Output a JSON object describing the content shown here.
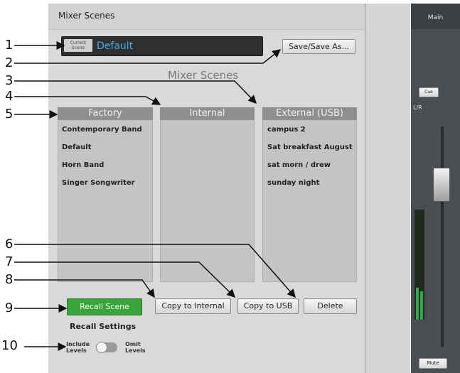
{
  "window_title": "Mixer Scenes",
  "current_scene": {
    "tag": "Current Scene",
    "name": "Default"
  },
  "save_button": "Save/Save As...",
  "section_title": "Mixer Scenes",
  "columns": {
    "factory": {
      "header": "Factory",
      "items": [
        "Contemporary Band",
        "Default",
        "Horn Band",
        "Singer Songwriter"
      ]
    },
    "internal": {
      "header": "Internal",
      "items": []
    },
    "external": {
      "header": "External (USB)",
      "items": [
        "campus 2",
        "Sat breakfast August",
        "sat morn / drew",
        "sunday night"
      ]
    }
  },
  "buttons": {
    "recall": "Recall Scene",
    "copy_internal": "Copy to Internal",
    "copy_usb": "Copy to USB",
    "delete": "Delete"
  },
  "recall_settings": {
    "title": "Recall Settings",
    "include": "Include Levels",
    "omit": "Omit Levels",
    "state": "include"
  },
  "main_strip": {
    "title": "Main",
    "cue": "Cue",
    "lr": "L/R",
    "mute": "Mute"
  },
  "callouts": [
    "1",
    "2",
    "3",
    "4",
    "5",
    "6",
    "7",
    "8",
    "9",
    "10"
  ],
  "colors": {
    "accent_blue": "#3eb1e8",
    "recall_green": "#3aa43a",
    "header_gray": "#8f8f8f"
  }
}
